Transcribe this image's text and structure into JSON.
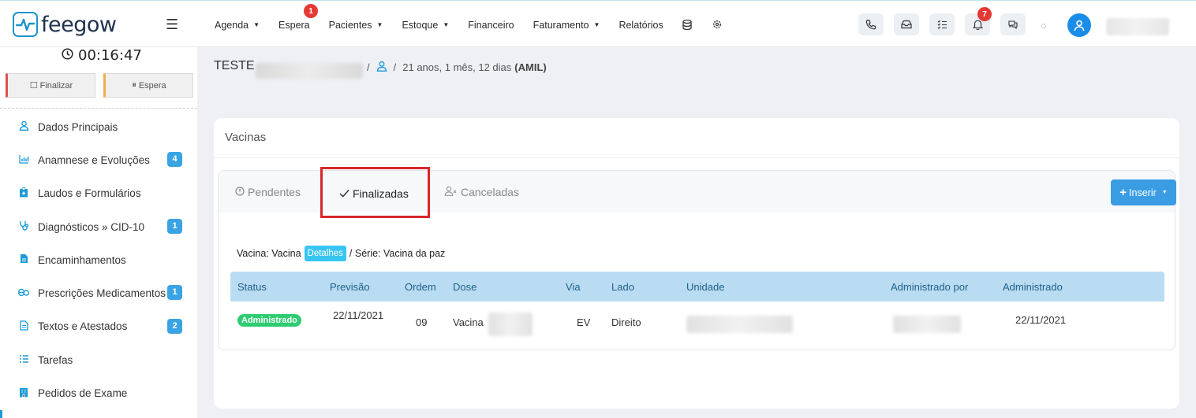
{
  "topbar": {
    "logo_text": "feegow",
    "nav": [
      {
        "label": "Agenda",
        "caret": true
      },
      {
        "label": "Espera",
        "caret": false,
        "badge": "1"
      },
      {
        "label": "Pacientes",
        "caret": true
      },
      {
        "label": "Estoque",
        "caret": true
      },
      {
        "label": "Financeiro",
        "caret": false
      },
      {
        "label": "Faturamento",
        "caret": true
      },
      {
        "label": "Relatórios",
        "caret": false
      }
    ],
    "nav_icons": [
      "database-icon",
      "gear-icon"
    ],
    "icons": [
      "phone-icon",
      "inbox-icon",
      "checklist-icon",
      "bell-icon",
      "chat-icon"
    ],
    "bell_badge": "7"
  },
  "sidebar": {
    "timer": "00:16:47",
    "finish_label": "Finalizar",
    "wait_label": "Espera",
    "items": [
      {
        "label": "Dados Principais",
        "icon": "user-icon",
        "count": ""
      },
      {
        "label": "Anamnese e Evoluções",
        "icon": "chart-icon",
        "count": "4"
      },
      {
        "label": "Laudos e Formulários",
        "icon": "clipboard-icon",
        "count": ""
      },
      {
        "label": "Diagnósticos » CID-10",
        "icon": "stethoscope-icon",
        "count": "1"
      },
      {
        "label": "Encaminhamentos",
        "icon": "document-icon",
        "count": ""
      },
      {
        "label": "Prescrições Medicamentos",
        "icon": "pills-icon",
        "count": "1"
      },
      {
        "label": "Textos e Atestados",
        "icon": "file-text-icon",
        "count": "2"
      },
      {
        "label": "Tarefas",
        "icon": "list-icon",
        "count": ""
      },
      {
        "label": "Pedidos de Exame",
        "icon": "building-icon",
        "count": ""
      }
    ]
  },
  "patient": {
    "name": "TESTE",
    "age_text": "21 anos, 1 mês, 12 dias",
    "insurance": "(AMIL)"
  },
  "card": {
    "title": "Vacinas",
    "tabs": [
      {
        "label": "Pendentes",
        "icon": "info-circle-icon",
        "active": false
      },
      {
        "label": "Finalizadas",
        "icon": "check-icon",
        "active": true
      },
      {
        "label": "Canceladas",
        "icon": "user-x-icon",
        "active": false
      }
    ],
    "insert_label": "Inserir",
    "vaccine_prefix": "Vacina: Vacina",
    "details_label": "Detalhes",
    "serie_text": "/ Série: Vacina da paz",
    "table": {
      "headers": [
        "Status",
        "Previsão",
        "Ordem",
        "Dose",
        "Via",
        "Lado",
        "Unidade",
        "Administrado por",
        "Administrado"
      ],
      "rows": [
        {
          "status": "Administrado",
          "previsao": "22/11/2021",
          "ordem": "09",
          "dose": "Vacina",
          "via": "EV",
          "lado": "Direito",
          "administrado": "22/11/2021"
        }
      ]
    }
  }
}
